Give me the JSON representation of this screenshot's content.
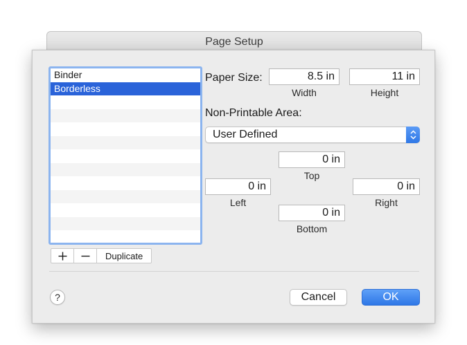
{
  "window": {
    "title": "Page Setup"
  },
  "paper_list": {
    "items": [
      {
        "label": "Binder",
        "selected": false
      },
      {
        "label": "Borderless",
        "selected": true
      }
    ],
    "add_icon": "plus-icon",
    "remove_icon": "minus-icon",
    "duplicate_label": "Duplicate"
  },
  "paper_size": {
    "label": "Paper Size:",
    "width_value": "8.5 in",
    "width_label": "Width",
    "height_value": "11 in",
    "height_label": "Height"
  },
  "non_printable": {
    "label": "Non-Printable Area:",
    "preset": "User Defined",
    "top_value": "0 in",
    "top_label": "Top",
    "left_value": "0 in",
    "left_label": "Left",
    "right_value": "0 in",
    "right_label": "Right",
    "bottom_value": "0 in",
    "bottom_label": "Bottom"
  },
  "footer": {
    "help_label": "?",
    "cancel_label": "Cancel",
    "ok_label": "OK"
  },
  "colors": {
    "accent": "#2e77e6",
    "selection": "#2a63d9",
    "focus_ring": "#8bb4ef"
  }
}
